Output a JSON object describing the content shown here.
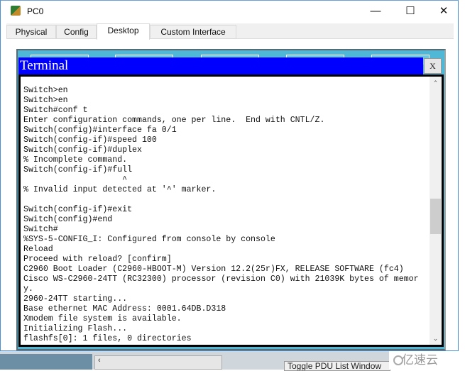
{
  "window": {
    "title": "PC0",
    "icon": "packet-tracer-pc-icon",
    "minimize": "—",
    "maximize": "☐",
    "close": "✕"
  },
  "tabs": [
    {
      "label": "Physical"
    },
    {
      "label": "Config"
    },
    {
      "label": "Desktop",
      "active": true
    },
    {
      "label": "Custom Interface"
    }
  ],
  "terminal": {
    "title": "Terminal",
    "close_label": "X",
    "header_color": "#0000ff",
    "lines": [
      "Switch>en",
      "Switch>en",
      "Switch#conf t",
      "Enter configuration commands, one per line.  End with CNTL/Z.",
      "Switch(config)#interface fa 0/1",
      "Switch(config-if)#speed 100",
      "Switch(config-if)#duplex",
      "% Incomplete command.",
      "Switch(config-if)#full",
      "                    ^",
      "% Invalid input detected at '^' marker.",
      "",
      "Switch(config-if)#exit",
      "Switch(config)#end",
      "Switch#",
      "%SYS-5-CONFIG_I: Configured from console by console",
      "Reload",
      "Proceed with reload? [confirm]",
      "C2960 Boot Loader (C2960-HBOOT-M) Version 12.2(25r)FX, RELEASE SOFTWARE (fc4)",
      "Cisco WS-C2960-24TT (RC32300) processor (revision C0) with 21039K bytes of memor",
      "y.",
      "2960-24TT starting...",
      "Base ethernet MAC Address: 0001.64DB.D318",
      "Xmodem file system is available.",
      "Initializing Flash...",
      "flashfs[0]: 1 files, 0 directories"
    ]
  },
  "background": {
    "toggle_pdu": "Toggle PDU List Window"
  },
  "watermark": "亿速云"
}
